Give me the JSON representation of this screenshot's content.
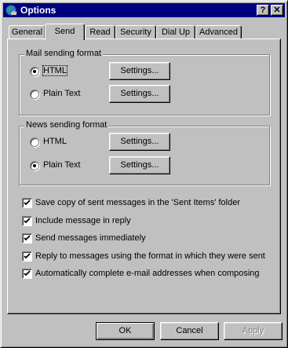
{
  "window": {
    "title": "Options",
    "help_button": "?",
    "close_button": "✕"
  },
  "tabs": [
    {
      "label": "General",
      "selected": false
    },
    {
      "label": "Send",
      "selected": true
    },
    {
      "label": "Read",
      "selected": false
    },
    {
      "label": "Security",
      "selected": false
    },
    {
      "label": "Dial Up",
      "selected": false
    },
    {
      "label": "Advanced",
      "selected": false
    }
  ],
  "mail_format": {
    "group_label": "Mail sending format",
    "html_label": "HTML",
    "plain_label": "Plain Text",
    "selected": "HTML",
    "settings_html": "Settings...",
    "settings_plain": "Settings..."
  },
  "news_format": {
    "group_label": "News sending format",
    "html_label": "HTML",
    "plain_label": "Plain Text",
    "selected": "Plain Text",
    "settings_html": "Settings...",
    "settings_plain": "Settings..."
  },
  "options": [
    {
      "label": "Save copy of sent messages in the 'Sent Items' folder",
      "checked": true
    },
    {
      "label": "Include message in reply",
      "checked": true
    },
    {
      "label": "Send messages immediately",
      "checked": true
    },
    {
      "label": "Reply to messages using the format in which they were sent",
      "checked": true
    },
    {
      "label": "Automatically complete e-mail addresses when composing",
      "checked": true
    }
  ],
  "footer": {
    "ok": "OK",
    "cancel": "Cancel",
    "apply": "Apply"
  },
  "colors": {
    "titlebar": "#000080",
    "face": "#c0c0c0",
    "disabled_text": "#808080"
  }
}
